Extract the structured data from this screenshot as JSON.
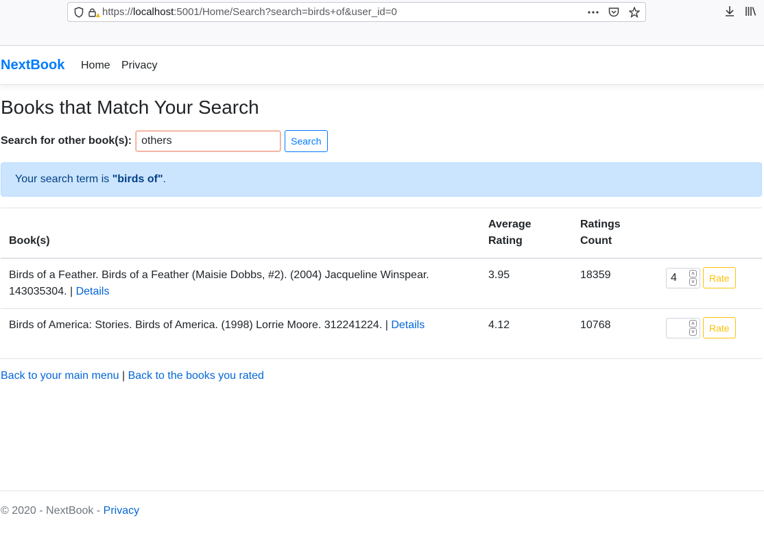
{
  "browser": {
    "url_prefix": "https://",
    "url_host": "localhost",
    "url_rest": ":5001/Home/Search?search=birds+of&user_id=0"
  },
  "navbar": {
    "brand": "NextBook",
    "links": [
      "Home",
      "Privacy"
    ]
  },
  "page": {
    "title": "Books that Match Your Search",
    "search_label": "Search for other book(s):",
    "search_value": "others",
    "search_button": "Search",
    "alert_prefix": "Your search term is ",
    "alert_term": "\"birds of\"",
    "alert_suffix": "."
  },
  "table": {
    "headers": [
      "Book(s)",
      "Average Rating",
      "Ratings Count"
    ],
    "rows": [
      {
        "book": "Birds of a Feather. Birds of a Feather (Maisie Dobbs, #2). (2004) Jacqueline Winspear. 143035304. | ",
        "details": "Details",
        "avg": "3.95",
        "count": "18359",
        "rating_value": "4",
        "rate_label": "Rate"
      },
      {
        "book": "Birds of America: Stories. Birds of America. (1998) Lorrie Moore. 312241224. | ",
        "details": "Details",
        "avg": "4.12",
        "count": "10768",
        "rating_value": "",
        "rate_label": "Rate"
      }
    ]
  },
  "links": {
    "back_main": "Back to your main menu",
    "separator": " | ",
    "back_rated": "Back to the books you rated"
  },
  "footer": {
    "text": "© 2020 - NextBook - ",
    "privacy": "Privacy"
  },
  "colors": {
    "brand": "#007bff",
    "link": "#0366d6",
    "alert_bg": "#cce5ff",
    "rate": "#ffc107"
  }
}
